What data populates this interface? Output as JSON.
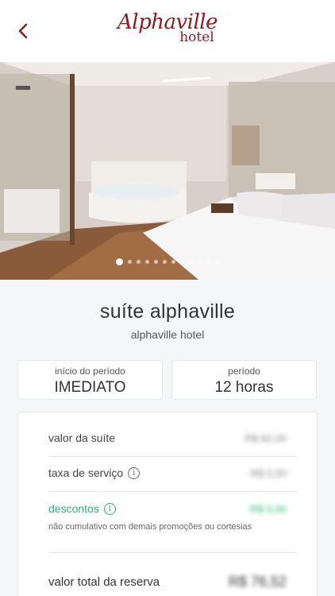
{
  "header": {
    "logo_line1": "Alphaville",
    "logo_line2": "hotel",
    "brand_color": "#8e1a1f",
    "back_icon": "chevron-left-icon"
  },
  "gallery": {
    "slide_count": 12,
    "active_index": 0
  },
  "suite": {
    "name": "suíte alphaville",
    "hotel": "alphaville hotel"
  },
  "period_start": {
    "label": "início do período",
    "value": "IMEDIATO"
  },
  "period": {
    "label": "período",
    "value": "12 horas"
  },
  "pricing": {
    "suite_value_label": "valor da suíte",
    "suite_value": "R$ 82,00",
    "service_fee_label": "taxa de serviço",
    "service_fee": "R$ 0,00",
    "discounts_label": "descontos",
    "discounts": "-R$ 0,00",
    "discount_note": "não cumulativo com demais promoções ou cortesias",
    "total_label": "valor total da reserva",
    "total": "R$ 76,52",
    "discount_color": "#2bb673"
  }
}
